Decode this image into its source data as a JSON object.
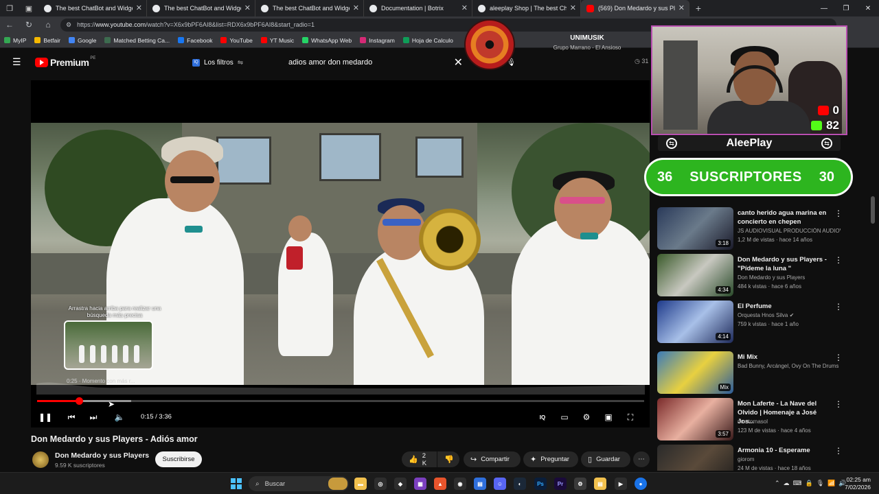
{
  "browser": {
    "tabs": [
      {
        "title": "The best ChatBot and Widgets fo",
        "active": false,
        "icon": "botrix-icon"
      },
      {
        "title": "The best ChatBot and Widgets fo",
        "active": false,
        "icon": "botrix-icon"
      },
      {
        "title": "The best ChatBot and Widgets fo",
        "active": false,
        "icon": "botrix-icon"
      },
      {
        "title": "Documentation | Botrix",
        "active": false,
        "icon": "botrix-icon"
      },
      {
        "title": "aleeplay Shop | The best ChatBot",
        "active": false,
        "icon": "botrix-icon"
      },
      {
        "title": "(569) Don Medardo y sus Pla",
        "active": true,
        "icon": "youtube-icon"
      }
    ],
    "new_tab": "+",
    "url_prefix": "https://",
    "url_domain": "www.youtube.com",
    "url_path": "/watch?v=X6x9bPF6AI8&list=RDX6x9bPF6AI8&start_radio=1",
    "bookmarks": [
      {
        "label": "MyIP",
        "color": "#34a853"
      },
      {
        "label": "Betfair",
        "color": "#f5b800"
      },
      {
        "label": "Google",
        "color": "#4285f4"
      },
      {
        "label": "Matched Betting Ca...",
        "color": "#3d6b4f"
      },
      {
        "label": "Facebook",
        "color": "#1877f2"
      },
      {
        "label": "YouTube",
        "color": "#ff0000"
      },
      {
        "label": "YT Music",
        "color": "#ff0000"
      },
      {
        "label": "WhatsApp Web",
        "color": "#25d366"
      },
      {
        "label": "Instagram",
        "color": "#d62976"
      },
      {
        "label": "Hoja de Calculo",
        "color": "#0f9d58"
      }
    ]
  },
  "youtube": {
    "logo_text": "Premium",
    "logo_country": "PE",
    "filters_label": "Los filtros",
    "search_value": "adios amor don medardo",
    "timer_text": "31"
  },
  "now_playing": {
    "title": "UNIMUSIK",
    "artist": "Grupo Marrano - El Ansioso"
  },
  "player": {
    "drag_hint": "Arrastra hacia arriba para realizar una búsqueda más precisa",
    "preview_label": "0:25 · Momento con más r...",
    "current_time": "0:15",
    "duration": "3:36",
    "time_display": "0:15 / 3:36",
    "progress_played": 0.0694,
    "progress_buffered": 0.155
  },
  "video": {
    "title": "Don Medardo y sus Players - Adiós amor",
    "channel_name": "Don Medardo y sus Players",
    "channel_subs": "9.59 K suscriptores",
    "subscribe_label": "Suscribirse",
    "likes": "2 K",
    "share_label": "Compartir",
    "ask_label": "Preguntar",
    "save_label": "Guardar"
  },
  "overlay": {
    "yt_count": "0",
    "kick_count": "82",
    "streamer_name": "AleePlay",
    "subs_current": "36",
    "subs_label": "SUSCRIPTORES",
    "subs_goal": "30"
  },
  "recommendations": [
    {
      "title": "canto herido agua marina en concierto en chepen",
      "channel": "JS AUDIOVISUAL PRODUCCIÓN AUDIOVI...",
      "meta": "1,2 M de vistas · hace 14 años",
      "duration": "3:18",
      "verified": false,
      "watched": 0
    },
    {
      "title": "Don Medardo y sus Players - \"Pídeme la luna \"",
      "channel": "Don Medardo y sus Players",
      "meta": "484 k vistas · hace 6 años",
      "duration": "4:34",
      "verified": false,
      "watched": 0
    },
    {
      "title": "El Perfume",
      "channel": "Orquesta Hnos Silva",
      "meta": "759 k vistas · hace 1 año",
      "duration": "4:14",
      "verified": true,
      "watched": 0
    },
    {
      "title": "Mi Mix",
      "channel": "Bad Bunny, Arcángel, Ovy On The Drums ...",
      "meta": "",
      "duration": "Mix",
      "verified": false,
      "watched": 0
    },
    {
      "title": "Mon Laferte - La Nave del Olvido | Homenaje a José Jos...",
      "channel": "montornasol",
      "meta": "123 M de vistas · hace 4 años",
      "duration": "3:57",
      "verified": false,
      "watched": 0
    },
    {
      "title": "Armonia 10 - Esperame",
      "channel": "giorom",
      "meta": "24 M de vistas · hace 18 años",
      "duration": "",
      "verified": false,
      "watched": 1
    }
  ],
  "taskbar": {
    "search_label": "Buscar",
    "time": "02:25 am",
    "date": "7/02/2026"
  }
}
